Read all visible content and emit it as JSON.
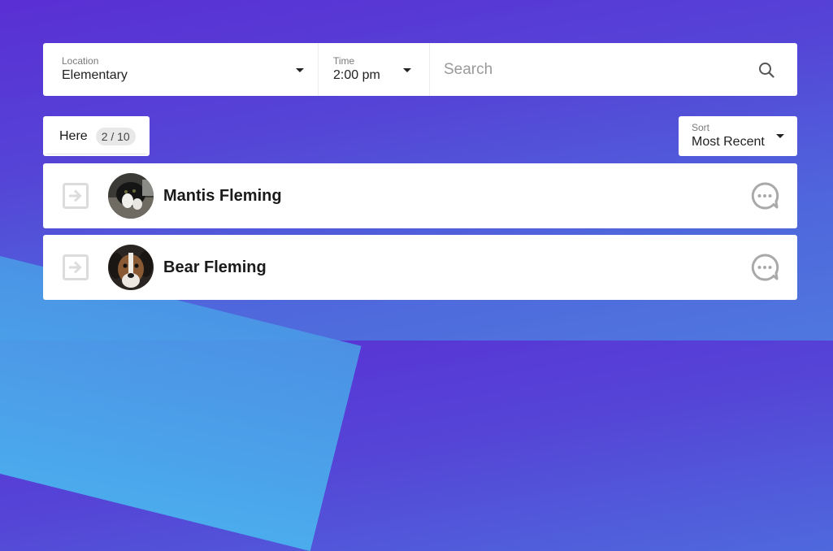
{
  "filters": {
    "location": {
      "label": "Location",
      "value": "Elementary"
    },
    "time": {
      "label": "Time",
      "value": "2:00 pm"
    },
    "search": {
      "placeholder": "Search",
      "value": ""
    }
  },
  "tab": {
    "label": "Here",
    "count": "2 / 10"
  },
  "sort": {
    "label": "Sort",
    "value": "Most Recent"
  },
  "people": [
    {
      "name": "Mantis Fleming"
    },
    {
      "name": "Bear Fleming"
    }
  ],
  "icons": {
    "checkin": "arrow-into-box-icon",
    "message": "chat-bubble-icon",
    "search": "search-icon"
  }
}
